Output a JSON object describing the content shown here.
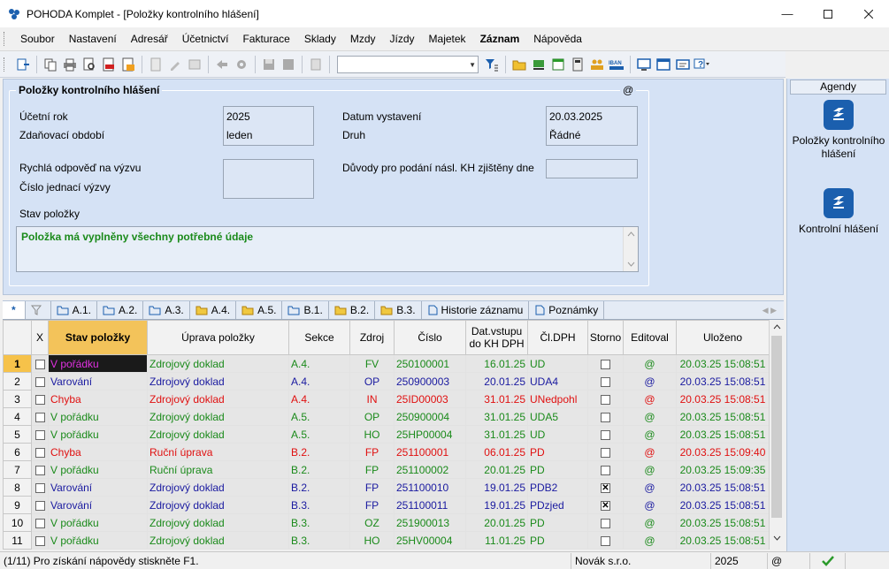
{
  "window": {
    "title": "POHODA Komplet - [Položky kontrolního hlášení]"
  },
  "menu": [
    "Soubor",
    "Nastavení",
    "Adresář",
    "Účetnictví",
    "Fakturace",
    "Sklady",
    "Mzdy",
    "Jízdy",
    "Majetek",
    "Záznam",
    "Nápověda"
  ],
  "form": {
    "group_title": "Položky kontrolního hlášení",
    "at": "@",
    "ucetni_rok_label": "Účetní rok",
    "ucetni_rok": "2025",
    "obdobi_label": "Zdaňovací období",
    "obdobi": "leden",
    "datum_label": "Datum vystavení",
    "datum": "20.03.2025",
    "druh_label": "Druh",
    "druh": "Řádné",
    "rychla_label": "Rychlá odpověď na výzvu",
    "cislo_jed_label": "Číslo jednací výzvy",
    "duvody_label": "Důvody pro podání násl. KH zjištěny dne",
    "stav_label": "Stav položky",
    "stav_text": "Položka má vyplněny všechny potřebné údaje"
  },
  "agenda": {
    "header": "Agendy",
    "items": [
      "Položky kontrolního hlášení",
      "Kontrolní hlášení"
    ]
  },
  "tabs": [
    "*",
    "A.1.",
    "A.2.",
    "A.3.",
    "A.4.",
    "A.5.",
    "B.1.",
    "B.2.",
    "B.3.",
    "Historie záznamu",
    "Poznámky"
  ],
  "grid": {
    "headers": [
      "X",
      "Stav položky",
      "Úprava položky",
      "Sekce",
      "Zdroj",
      "Číslo",
      "Dat.vstupu do KH DPH",
      "Čl.DPH",
      "Storno",
      "Editoval",
      "Uloženo"
    ],
    "rows": [
      {
        "n": "1",
        "stav": "V pořádku",
        "uprava": "Zdrojový doklad",
        "sekce": "A.4.",
        "zdroj": "FV",
        "cislo": "250100001",
        "datum": "16.01.25",
        "cl": "UD",
        "storno": false,
        "edit": "@",
        "ulozeno": "20.03.25 15:08:51",
        "color": "#1a8a1a",
        "stav_color": "#e030e0",
        "uprava_color": "#1a8a1a"
      },
      {
        "n": "2",
        "stav": "Varování",
        "uprava": "Zdrojový doklad",
        "sekce": "A.4.",
        "zdroj": "OP",
        "cislo": "250900003",
        "datum": "20.01.25",
        "cl": "UDA4",
        "storno": false,
        "edit": "@",
        "ulozeno": "20.03.25 15:08:51",
        "color": "#1a1aa0",
        "stav_color": "#1a1aa0",
        "uprava_color": "#1a1aa0"
      },
      {
        "n": "3",
        "stav": "Chyba",
        "uprava": "Zdrojový doklad",
        "sekce": "A.4.",
        "zdroj": "IN",
        "cislo": "25ID00003",
        "datum": "31.01.25",
        "cl": "UNedpohl",
        "storno": false,
        "edit": "@",
        "ulozeno": "20.03.25 15:08:51",
        "color": "#e01010",
        "stav_color": "#e01010",
        "uprava_color": "#e01010"
      },
      {
        "n": "4",
        "stav": "V pořádku",
        "uprava": "Zdrojový doklad",
        "sekce": "A.5.",
        "zdroj": "OP",
        "cislo": "250900004",
        "datum": "31.01.25",
        "cl": "UDA5",
        "storno": false,
        "edit": "@",
        "ulozeno": "20.03.25 15:08:51",
        "color": "#1a8a1a",
        "stav_color": "#1a8a1a",
        "uprava_color": "#1a8a1a"
      },
      {
        "n": "5",
        "stav": "V pořádku",
        "uprava": "Zdrojový doklad",
        "sekce": "A.5.",
        "zdroj": "HO",
        "cislo": "25HP00004",
        "datum": "31.01.25",
        "cl": "UD",
        "storno": false,
        "edit": "@",
        "ulozeno": "20.03.25 15:08:51",
        "color": "#1a8a1a",
        "stav_color": "#1a8a1a",
        "uprava_color": "#1a8a1a"
      },
      {
        "n": "6",
        "stav": "Chyba",
        "uprava": "Ruční úprava",
        "sekce": "B.2.",
        "zdroj": "FP",
        "cislo": "251100001",
        "datum": "06.01.25",
        "cl": "PD",
        "storno": false,
        "edit": "@",
        "ulozeno": "20.03.25 15:09:40",
        "color": "#e01010",
        "stav_color": "#e01010",
        "uprava_color": "#e01010"
      },
      {
        "n": "7",
        "stav": "V pořádku",
        "uprava": "Ruční úprava",
        "sekce": "B.2.",
        "zdroj": "FP",
        "cislo": "251100002",
        "datum": "20.01.25",
        "cl": "PD",
        "storno": false,
        "edit": "@",
        "ulozeno": "20.03.25 15:09:35",
        "color": "#1a8a1a",
        "stav_color": "#1a8a1a",
        "uprava_color": "#1a8a1a"
      },
      {
        "n": "8",
        "stav": "Varování",
        "uprava": "Zdrojový doklad",
        "sekce": "B.2.",
        "zdroj": "FP",
        "cislo": "251100010",
        "datum": "19.01.25",
        "cl": "PDB2",
        "storno": true,
        "edit": "@",
        "ulozeno": "20.03.25 15:08:51",
        "color": "#1a1aa0",
        "stav_color": "#1a1aa0",
        "uprava_color": "#1a1aa0"
      },
      {
        "n": "9",
        "stav": "Varování",
        "uprava": "Zdrojový doklad",
        "sekce": "B.3.",
        "zdroj": "FP",
        "cislo": "251100011",
        "datum": "19.01.25",
        "cl": "PDzjed",
        "storno": true,
        "edit": "@",
        "ulozeno": "20.03.25 15:08:51",
        "color": "#1a1aa0",
        "stav_color": "#1a1aa0",
        "uprava_color": "#1a1aa0"
      },
      {
        "n": "10",
        "stav": "V pořádku",
        "uprava": "Zdrojový doklad",
        "sekce": "B.3.",
        "zdroj": "OZ",
        "cislo": "251900013",
        "datum": "20.01.25",
        "cl": "PD",
        "storno": false,
        "edit": "@",
        "ulozeno": "20.03.25 15:08:51",
        "color": "#1a8a1a",
        "stav_color": "#1a8a1a",
        "uprava_color": "#1a8a1a"
      },
      {
        "n": "11",
        "stav": "V pořádku",
        "uprava": "Zdrojový doklad",
        "sekce": "B.3.",
        "zdroj": "HO",
        "cislo": "25HV00004",
        "datum": "11.01.25",
        "cl": "PD",
        "storno": false,
        "edit": "@",
        "ulozeno": "20.03.25 15:08:51",
        "color": "#1a8a1a",
        "stav_color": "#1a8a1a",
        "uprava_color": "#1a8a1a"
      }
    ]
  },
  "status": {
    "hint": "(1/11) Pro získání nápovědy stiskněte F1.",
    "user": "Novák s.r.o.",
    "year": "2025",
    "at": "@"
  }
}
